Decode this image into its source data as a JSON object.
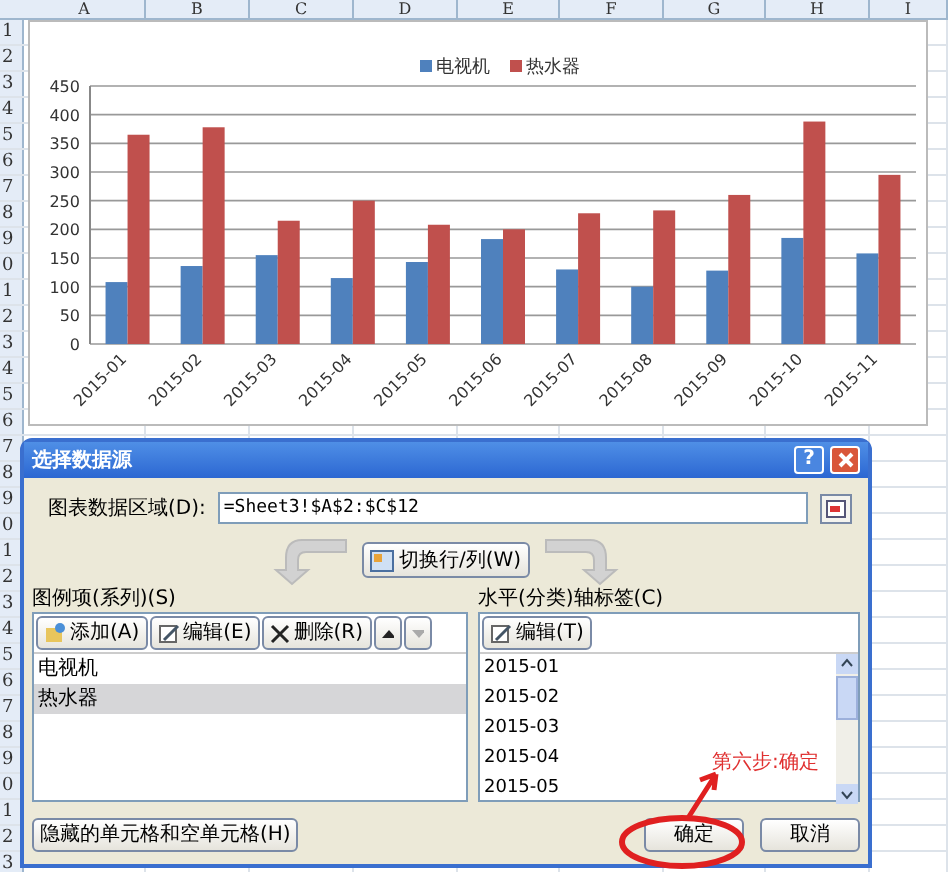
{
  "sheet": {
    "columns": [
      "A",
      "B",
      "C",
      "D",
      "E",
      "F",
      "G",
      "H",
      "I"
    ],
    "rows": [
      "1",
      "2",
      "3",
      "4",
      "5",
      "6",
      "7",
      "8",
      "9",
      "0",
      "1",
      "2",
      "3",
      "4",
      "5",
      "6",
      "7",
      "8",
      "9",
      "0",
      "1",
      "2",
      "3",
      "4",
      "5",
      "6",
      "7",
      "8",
      "9",
      "0",
      "1",
      "2",
      "3"
    ]
  },
  "chart": {
    "chart_data": {
      "type": "bar",
      "categories": [
        "2015-01",
        "2015-02",
        "2015-03",
        "2015-04",
        "2015-05",
        "2015-06",
        "2015-07",
        "2015-08",
        "2015-09",
        "2015-10",
        "2015-11"
      ],
      "series": [
        {
          "name": "电视机",
          "color": "#4f81bd",
          "values": [
            108,
            136,
            155,
            115,
            143,
            183,
            130,
            100,
            128,
            185,
            158
          ]
        },
        {
          "name": "热水器",
          "color": "#c0504d",
          "values": [
            365,
            378,
            215,
            250,
            208,
            200,
            228,
            233,
            260,
            388,
            295
          ]
        }
      ],
      "grid": true,
      "legend": "top",
      "ylim": [
        0,
        450
      ],
      "yticks": [
        0,
        50,
        100,
        150,
        200,
        250,
        300,
        350,
        400,
        450
      ]
    }
  },
  "dialog": {
    "title": "选择数据源",
    "help": "?",
    "range_label": "图表数据区域(D):",
    "range_value": "=Sheet3!$A$2:$C$12",
    "switch_button": "切换行/列(W)",
    "series_label": "图例项(系列)(S)",
    "series_buttons": [
      {
        "kind": "add",
        "label": "添加(A)",
        "disabled": false
      },
      {
        "kind": "edit",
        "label": "编辑(E)",
        "disabled": false
      },
      {
        "kind": "delete",
        "label": "删除(R)",
        "disabled": false
      },
      {
        "kind": "up",
        "disabled": false
      },
      {
        "kind": "down",
        "disabled": true
      }
    ],
    "series": [
      {
        "label": "电视机",
        "selected": false
      },
      {
        "label": "热水器",
        "selected": true
      }
    ],
    "category_label": "水平(分类)轴标签(C)",
    "category_button": "编辑(T)",
    "categories": [
      "2015-01",
      "2015-02",
      "2015-03",
      "2015-04",
      "2015-05"
    ],
    "hidden_cells_button": "隐藏的单元格和空单元格(H)",
    "buttons": [
      {
        "label": "确定"
      },
      {
        "label": "取消"
      }
    ]
  },
  "annotation": {
    "text": "第六步:确定"
  }
}
